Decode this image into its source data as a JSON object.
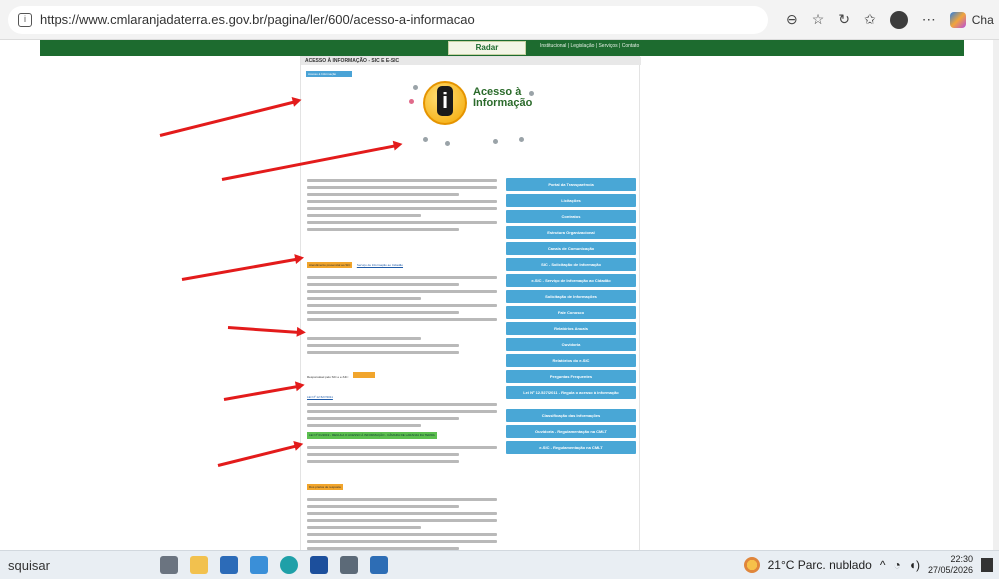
{
  "browser": {
    "url": "https://www.cmlaranjadaterra.es.gov.br/pagina/ler/600/acesso-a-informacao",
    "copilot_label": "Cha"
  },
  "site": {
    "logo": "Radar",
    "nav": "Institucional  |  Legislação  |  Serviços  |  Contato",
    "page_title": "ACESSO À INFORMAÇÃO - SIC E E-SIC",
    "breadcrumb": "Acesso à Informação",
    "hero_title": "Acesso à Informação"
  },
  "content": {
    "section1_label": "Atendimento presencial ao SIC",
    "section1_link": "Serviço de Informação ao Cidadão",
    "responsible_label": "Responsável pelo SIC e e-SIC:",
    "law_label": "LEI Nº 12.527/2011",
    "section2_label": "LEI Nº 01/2019 - REGULA O ACESSO À INFORMAÇÃO - CÂMARA DE LARANJA DA TERRA",
    "section3_label": "Dos prazos de resposta"
  },
  "side_menu": [
    "Portal da Transparência",
    "Licitações",
    "Contratos",
    "Estrutura Organizacional",
    "Canais de Comunicação",
    "SIC - Solicitação de Informação",
    "e-SIC - Serviço de Informação ao Cidadão",
    "Solicitação de Informações",
    "Fale Conosco",
    "Relatórios Anuais",
    "Ouvidoria",
    "Relatórios do e-SIC",
    "Perguntas Frequentes",
    "Lei Nº 12.527/2011 - Regula o acesso à informação",
    "Classificação das Informações",
    "Ouvidoria - Regulamentação na CMLT",
    "e-SIC - Regulamentação na CMLT"
  ],
  "taskbar": {
    "search": "squisar",
    "weather": "21°C  Parc. nublado",
    "time": "22:30",
    "date": "27/05/2026"
  }
}
